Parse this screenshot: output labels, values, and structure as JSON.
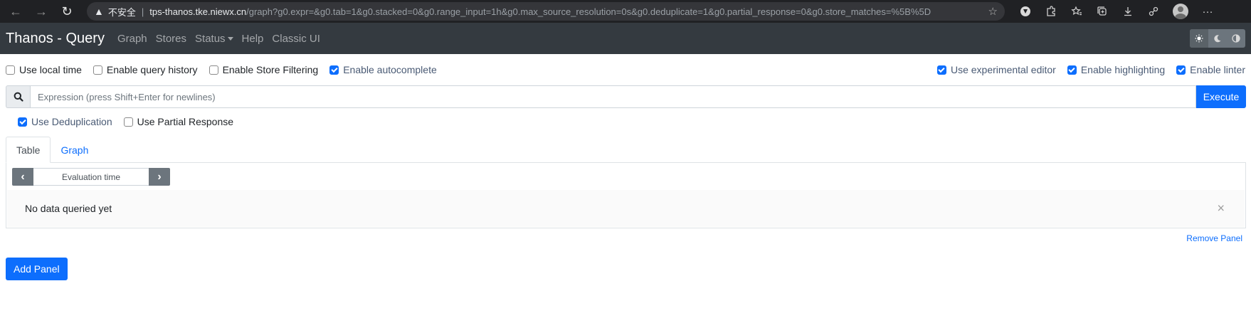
{
  "browser": {
    "back_icon": "←",
    "forward_icon": "→",
    "reload_icon": "↻",
    "warning_icon": "▲",
    "insecure_label": "不安全",
    "separator": "|",
    "host": "tps-thanos.tke.niewx.cn",
    "path": "/graph?g0.expr=&g0.tab=1&g0.stacked=0&g0.range_input=1h&g0.max_source_resolution=0s&g0.deduplicate=1&g0.partial_response=0&g0.store_matches=%5B%5D",
    "star_icon": "☆",
    "more_icon": "···"
  },
  "navbar": {
    "brand": "Thanos - Query",
    "links": [
      "Graph",
      "Stores",
      "Status",
      "Help",
      "Classic UI"
    ]
  },
  "options": {
    "use_local_time": "Use local time",
    "enable_query_history": "Enable query history",
    "enable_store_filtering": "Enable Store Filtering",
    "enable_autocomplete": "Enable autocomplete",
    "use_experimental_editor": "Use experimental editor",
    "enable_highlighting": "Enable highlighting",
    "enable_linter": "Enable linter"
  },
  "expression": {
    "placeholder": "Expression (press Shift+Enter for newlines)",
    "execute": "Execute"
  },
  "dedup": {
    "use_deduplication": "Use Deduplication",
    "use_partial_response": "Use Partial Response"
  },
  "panel": {
    "tabs": [
      "Table",
      "Graph"
    ],
    "evaluation_time": "Evaluation time",
    "prev_icon": "‹",
    "next_icon": "›",
    "no_data": "No data queried yet",
    "close_icon": "×",
    "remove_panel": "Remove Panel"
  },
  "add_panel": "Add Panel",
  "colors": {
    "primary": "#0d6efd",
    "navbar": "#343a40",
    "chrome": "#202124"
  }
}
